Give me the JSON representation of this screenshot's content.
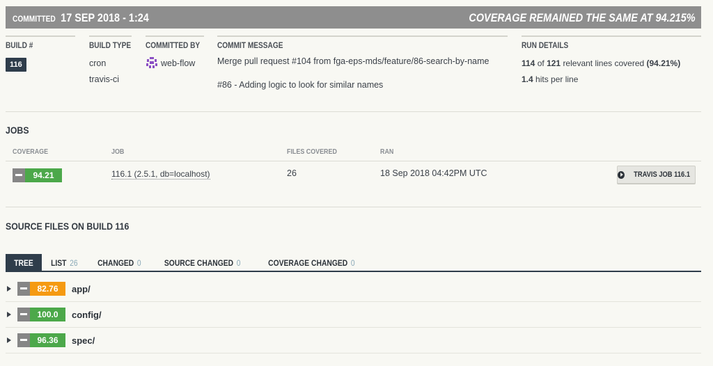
{
  "header": {
    "committed_label": "COMMITTED",
    "committed_date": "17 SEP 2018 - 1:24",
    "coverage_status": "COVERAGE REMAINED THE SAME AT 94.215%"
  },
  "build": {
    "build_label": "BUILD #",
    "build_number": "116",
    "build_type_label": "BUILD TYPE",
    "build_type_1": "cron",
    "build_type_2": "travis-ci",
    "committed_by_label": "COMMITTED BY",
    "committed_by": "web-flow",
    "commit_message_label": "COMMIT MESSAGE",
    "commit_message_1": "Merge pull request #104 from fga-eps-mds/feature/86-search-by-name",
    "commit_message_2": "#86 - Adding logic to look for similar names",
    "run_details_label": "RUN DETAILS",
    "lines_covered": "114",
    "of_text": "of",
    "lines_total": "121",
    "relevant_text": "relevant lines covered",
    "lines_pct": "(94.21%)",
    "hits": "1.4",
    "hits_text": "hits per line"
  },
  "jobs": {
    "title": "JOBS",
    "headers": {
      "coverage": "COVERAGE",
      "job": "JOB",
      "files": "FILES COVERED",
      "ran": "RAN"
    },
    "rows": [
      {
        "coverage": "94.21",
        "job": "116.1 (2.5.1, db=localhost)",
        "files": "26",
        "ran": "18 Sep 2018 04:42PM UTC",
        "button": "TRAVIS JOB 116.1"
      }
    ]
  },
  "source": {
    "title": "SOURCE FILES ON BUILD 116",
    "tabs": [
      {
        "label": "TREE",
        "count": ""
      },
      {
        "label": "LIST",
        "count": "26"
      },
      {
        "label": "CHANGED",
        "count": "0"
      },
      {
        "label": "SOURCE CHANGED",
        "count": "0"
      },
      {
        "label": "COVERAGE CHANGED",
        "count": "0"
      }
    ],
    "tree": [
      {
        "coverage": "82.76",
        "name": "app/"
      },
      {
        "coverage": "100.0",
        "name": "config/"
      },
      {
        "coverage": "96.36",
        "name": "spec/"
      }
    ]
  },
  "colors": {
    "header_bg": "#8e8e8e",
    "dark_navy": "#2f3d4b",
    "coverage_green": "#4ca84a",
    "coverage_orange": "#f59a12",
    "minus_gray": "#868686"
  },
  "icons": {
    "build_arrow": "arrow-circle-right-icon",
    "tree_toggle": "triangle-right-icon",
    "avatar": "web-flow-avatar"
  }
}
